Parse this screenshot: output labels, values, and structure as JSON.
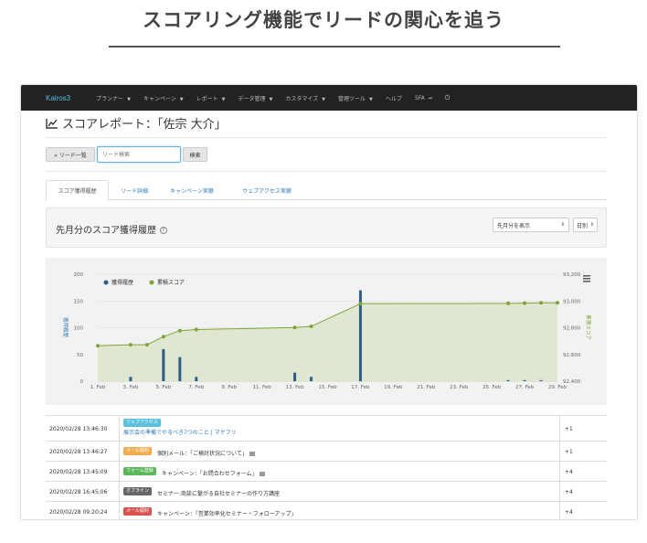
{
  "headline": "スコアリング機能でリードの関心を追う",
  "navbar": {
    "brand": "Kairos3",
    "items": [
      "プランナー",
      "キャンペーン",
      "レポート",
      "データ管理",
      "カスタマイズ",
      "管理ツール"
    ],
    "help": "ヘルプ",
    "sfa": "SFA"
  },
  "page_title": "スコアレポート：「佐宗 大介」",
  "toolbar": {
    "back_label": "« リード一覧",
    "search_placeholder": "リード検索",
    "search_button": "検索"
  },
  "tabs": [
    {
      "label": "スコア獲得履歴",
      "active": true
    },
    {
      "label": "リード詳細",
      "active": false
    },
    {
      "label": "キャンペーン実績",
      "active": false
    },
    {
      "label": "ウェブアクセス実績",
      "active": false
    }
  ],
  "section": {
    "title": "先月分のスコア獲得履歴",
    "help_icon": "?",
    "period_select": "先月分を表示",
    "unit_select": "日別"
  },
  "chart_data": {
    "type": "bar+line",
    "legend": [
      {
        "name": "獲得履歴",
        "color": "#2f5d8a"
      },
      {
        "name": "累積スコア",
        "color": "#7fa33a"
      }
    ],
    "legend_placement": "top-left",
    "left_axis": {
      "label": "獲得履歴",
      "ticks": [
        0,
        50,
        100,
        150,
        200
      ],
      "range": [
        0,
        200
      ]
    },
    "right_axis": {
      "label": "累積スコア",
      "ticks": [
        "92,400",
        "92,600",
        "92,800",
        "93,000",
        "93,200"
      ],
      "range": [
        92400,
        93200
      ]
    },
    "x_ticks": [
      "1. Feb",
      "3. Feb",
      "5. Feb",
      "7. Feb",
      "9. Feb",
      "11. Feb",
      "13. Feb",
      "15. Feb",
      "17. Feb",
      "19. Feb",
      "21. Feb",
      "23. Feb",
      "25. Feb",
      "27. Feb",
      "29. Feb"
    ],
    "x_range": [
      1,
      29
    ],
    "bars": [
      {
        "day": 3,
        "value": 8
      },
      {
        "day": 5,
        "value": 60
      },
      {
        "day": 6,
        "value": 45
      },
      {
        "day": 7,
        "value": 8
      },
      {
        "day": 13,
        "value": 16
      },
      {
        "day": 14,
        "value": 8
      },
      {
        "day": 17,
        "value": 170
      },
      {
        "day": 26,
        "value": 2
      },
      {
        "day": 27,
        "value": 2
      },
      {
        "day": 28,
        "value": 2
      }
    ],
    "line": [
      {
        "day": 1,
        "value": 92665
      },
      {
        "day": 3,
        "value": 92673
      },
      {
        "day": 4,
        "value": 92673
      },
      {
        "day": 5,
        "value": 92733
      },
      {
        "day": 6,
        "value": 92778
      },
      {
        "day": 7,
        "value": 92786
      },
      {
        "day": 13,
        "value": 92802
      },
      {
        "day": 14,
        "value": 92810
      },
      {
        "day": 17,
        "value": 92980
      },
      {
        "day": 26,
        "value": 92982
      },
      {
        "day": 27,
        "value": 92984
      },
      {
        "day": 28,
        "value": 92986
      },
      {
        "day": 29,
        "value": 92986
      }
    ],
    "colors": {
      "bar": "#2f5d8a",
      "line": "#7fa33a",
      "area": "#dde5cc"
    }
  },
  "history": [
    {
      "timestamp": "2020/02/28 13:46:30",
      "label": "ウェブアクセス",
      "label_color": "#5bc0de",
      "description": "展示会の準備でやるべき7つのこと | マケフリ",
      "points": "+1",
      "link": true
    },
    {
      "timestamp": "2020/02/28 13:46:27",
      "label": "メール開封",
      "label_color": "#f0ad4e",
      "description": "個別メール：「ご検討状況について」",
      "points": "+1",
      "link": false
    },
    {
      "timestamp": "2020/02/28 13:45:09",
      "label": "フォーム登録",
      "label_color": "#5cb85c",
      "description": "キャンペーン：「お問合わせフォーム」",
      "points": "+4",
      "link": false
    },
    {
      "timestamp": "2020/02/28 16:45:06",
      "label": "オフライン",
      "label_color": "#666666",
      "description": "セミナー:商談に繋がる自社セミナーの作り方講座",
      "points": "+4",
      "link": false
    },
    {
      "timestamp": "2020/02/28 09:20:24",
      "label": "メール開封",
      "label_color": "#d9534f",
      "description": "キャンペーン：「営業効率化セミナー・フォローアップ」",
      "points": "+4",
      "link": false
    }
  ]
}
